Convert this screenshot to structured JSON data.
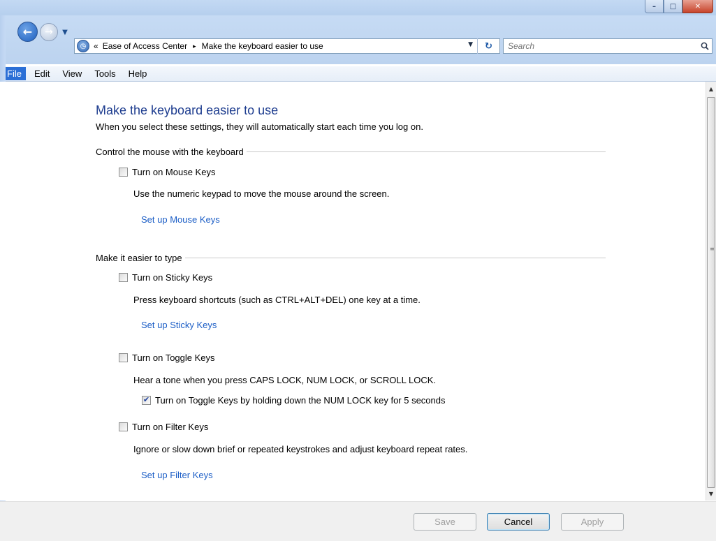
{
  "window": {
    "controls": {
      "minimize": "–",
      "maximize": "□",
      "close": "✕"
    }
  },
  "navigation": {
    "back_glyph": "←",
    "forward_glyph": "→",
    "recent_glyph": "▼"
  },
  "address": {
    "overflow": "«",
    "crumbs": [
      "Ease of Access Center",
      "Make the keyboard easier to use"
    ],
    "separator": "▸",
    "dropdown_glyph": "▼",
    "refresh_glyph": "↻"
  },
  "search": {
    "placeholder": "Search",
    "icon": "search-icon"
  },
  "menu": {
    "items": [
      "File",
      "Edit",
      "View",
      "Tools",
      "Help"
    ],
    "active": "File"
  },
  "page": {
    "title": "Make the keyboard easier to use",
    "subtitle": "When you select these settings, they will automatically start each time you log on."
  },
  "groups": {
    "mouse": {
      "heading": "Control the mouse with the keyboard",
      "mouse_keys": {
        "label": "Turn on Mouse Keys",
        "checked": false,
        "description": "Use the numeric keypad to move the mouse around the screen.",
        "link": "Set up Mouse Keys"
      }
    },
    "typing": {
      "heading": "Make it easier to type",
      "sticky_keys": {
        "label": "Turn on Sticky Keys",
        "checked": false,
        "description": "Press keyboard shortcuts (such as CTRL+ALT+DEL) one key at a time.",
        "link": "Set up Sticky Keys"
      },
      "toggle_keys": {
        "label": "Turn on Toggle Keys",
        "checked": false,
        "description": "Hear a tone when you press CAPS LOCK, NUM LOCK, or SCROLL LOCK.",
        "sub_option": {
          "label": "Turn on Toggle Keys by holding down the NUM LOCK key for 5 seconds",
          "checked": true
        }
      },
      "filter_keys": {
        "label": "Turn on Filter Keys",
        "checked": false,
        "description": "Ignore or slow down brief or repeated keystrokes and adjust keyboard repeat rates.",
        "link": "Set up Filter Keys"
      }
    }
  },
  "buttons": {
    "save": "Save",
    "cancel": "Cancel",
    "apply": "Apply"
  },
  "colors": {
    "title_blue": "#1e3d8f",
    "link_blue": "#1c5ec6",
    "menu_active": "#2b6fd6"
  }
}
